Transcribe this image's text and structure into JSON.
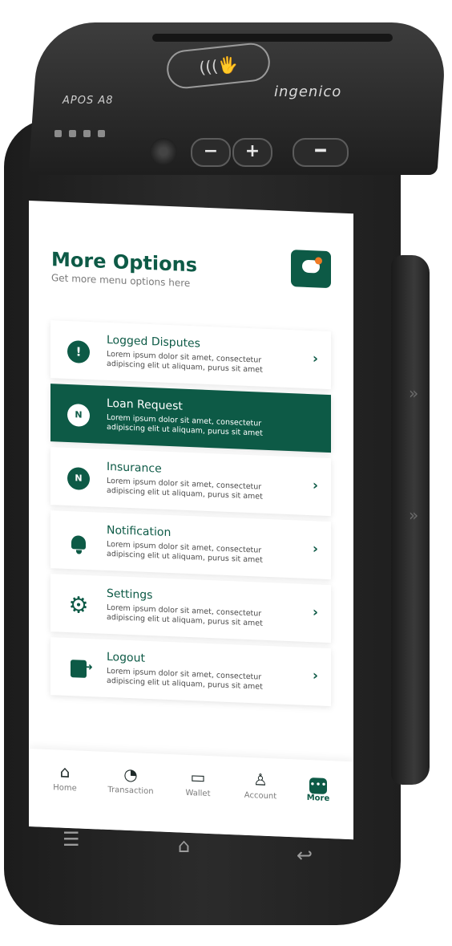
{
  "device": {
    "model_label": "APOS A8",
    "brand_label": "ingenico",
    "contactless_symbol": "(((🖐",
    "volume_down": "−",
    "volume_up": "+",
    "power": "━"
  },
  "header": {
    "title": "More Options",
    "subtitle": "Get more menu options here",
    "action_icon": "cloud-sun-icon"
  },
  "menu": [
    {
      "title": "Logged Disputes",
      "desc": "Lorem ipsum dolor sit amet, consectetur adipiscing elit ut aliquam, purus sit amet",
      "icon": "alert-icon",
      "active": false
    },
    {
      "title": "Loan Request",
      "desc": "Lorem ipsum dolor sit amet, consectetur adipiscing elit ut aliquam, purus sit amet",
      "icon": "hand-coin-icon",
      "active": true
    },
    {
      "title": "Insurance",
      "desc": "Lorem ipsum dolor sit amet, consectetur adipiscing elit ut aliquam, purus sit amet",
      "icon": "umbrella-coin-icon",
      "active": false
    },
    {
      "title": "Notification",
      "desc": "Lorem ipsum dolor sit amet, consectetur adipiscing elit ut aliquam, purus sit amet",
      "icon": "bell-icon",
      "active": false
    },
    {
      "title": "Settings",
      "desc": "Lorem ipsum dolor sit amet, consectetur adipiscing elit ut aliquam, purus sit amet",
      "icon": "gear-icon",
      "active": false
    },
    {
      "title": "Logout",
      "desc": "Lorem ipsum dolor sit amet, consectetur adipiscing elit ut aliquam, purus sit amet",
      "icon": "logout-icon",
      "active": false
    }
  ],
  "icons": {
    "alert": "!",
    "coin": "N",
    "gear": "⚙",
    "chevron": "›"
  },
  "nav": [
    {
      "label": "Home",
      "icon": "home-icon",
      "glyph": "⌂",
      "active": false
    },
    {
      "label": "Transaction",
      "icon": "pie-chart-icon",
      "glyph": "◔",
      "active": false
    },
    {
      "label": "Wallet",
      "icon": "wallet-icon",
      "glyph": "▭",
      "active": false
    },
    {
      "label": "Account",
      "icon": "user-icon",
      "glyph": "♙",
      "active": false
    },
    {
      "label": "More",
      "icon": "more-icon",
      "glyph": "•••",
      "active": true
    }
  ],
  "system_keys": {
    "menu": "☰",
    "home": "⌂",
    "back": "↩"
  },
  "colors": {
    "primary": "#0d5a46",
    "accent": "#f07a24",
    "device": "#2a2a2a"
  }
}
